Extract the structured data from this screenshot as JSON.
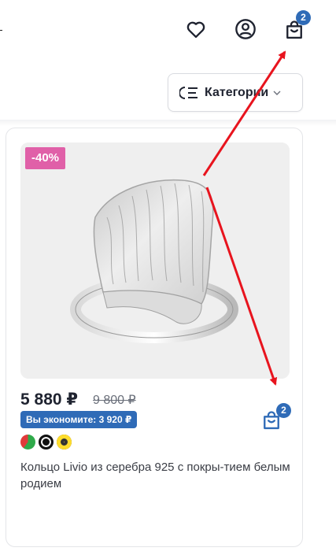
{
  "header": {
    "favorites_icon": "heart-icon",
    "account_icon": "user-circle-icon",
    "cart_icon": "shopping-bag-icon",
    "cart_count": "2"
  },
  "filters": {
    "categories_label": "Категории",
    "categories_icon": "list-filter-icon"
  },
  "product": {
    "discount": "-40%",
    "price": "5 880 ₽",
    "old_price": "9 800 ₽",
    "savings": "Вы экономите: 3 920 ₽",
    "title": "Кольцо Livio из серебра 925 с покры-тием белым родием",
    "cart_count": "2",
    "payment_icons": [
      "payment-icon-green",
      "payment-icon-dolyame",
      "payment-icon-yellow"
    ]
  },
  "colors": {
    "accent_blue": "#2f6bb7",
    "discount_pink": "#e060a8",
    "annotation_red": "#e8141e"
  }
}
